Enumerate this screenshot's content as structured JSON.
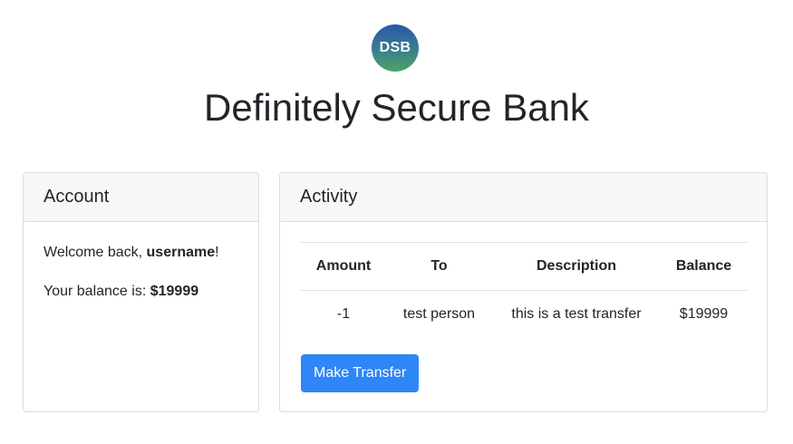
{
  "logo": {
    "text": "DSB"
  },
  "title": "Definitely Secure Bank",
  "account": {
    "header": "Account",
    "welcome_prefix": "Welcome back, ",
    "username": "username",
    "welcome_suffix": "!",
    "balance_prefix": "Your balance is: ",
    "balance": "$19999"
  },
  "activity": {
    "header": "Activity",
    "columns": [
      "Amount",
      "To",
      "Description",
      "Balance"
    ],
    "rows": [
      {
        "amount": "-1",
        "to": "test person",
        "description": "this is a test transfer",
        "balance": "$19999"
      }
    ],
    "button_label": "Make Transfer"
  },
  "colors": {
    "primary_button": "#2f86f6",
    "logo_gradient_top": "#2b56a8",
    "logo_gradient_bottom": "#4aa463"
  }
}
